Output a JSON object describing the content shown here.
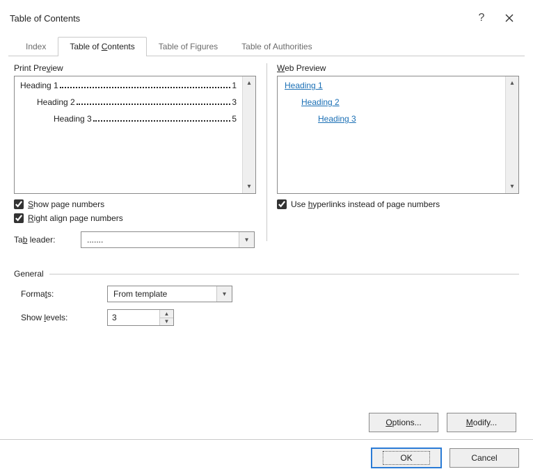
{
  "title": "Table of Contents",
  "tabs": {
    "index": "Index",
    "toc": "Table of Contents",
    "tof": "Table of Figures",
    "toa": "Table of Authorities"
  },
  "print_preview": {
    "label": "Print Preview",
    "rows": [
      {
        "text": "Heading 1",
        "page": "1",
        "indent": 0
      },
      {
        "text": "Heading 2",
        "page": "3",
        "indent": 1
      },
      {
        "text": "Heading 3",
        "page": "5",
        "indent": 2
      }
    ]
  },
  "web_preview": {
    "label": "Web Preview",
    "rows": [
      {
        "text": "Heading 1",
        "indent": 0
      },
      {
        "text": "Heading 2",
        "indent": 1
      },
      {
        "text": "Heading 3",
        "indent": 2
      }
    ]
  },
  "checks": {
    "show_page_numbers": "Show page numbers",
    "right_align": "Right align page numbers",
    "use_hyperlinks": "Use hyperlinks instead of page numbers"
  },
  "tab_leader": {
    "label": "Tab leader:",
    "value": "......."
  },
  "general": {
    "legend": "General",
    "formats_label": "Formats:",
    "formats_value": "From template",
    "levels_label": "Show levels:",
    "levels_value": "3"
  },
  "buttons": {
    "options": "Options...",
    "modify": "Modify...",
    "ok": "OK",
    "cancel": "Cancel"
  }
}
